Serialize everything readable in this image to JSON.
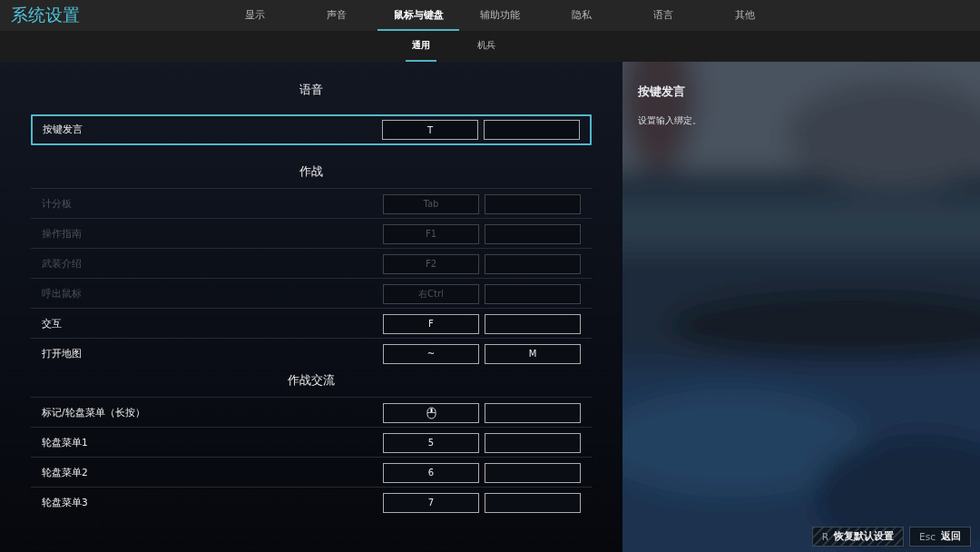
{
  "window": {
    "title": "系统设置"
  },
  "tabs": [
    {
      "label": "显示",
      "selected": false
    },
    {
      "label": "声音",
      "selected": false
    },
    {
      "label": "鼠标与键盘",
      "selected": true
    },
    {
      "label": "辅助功能",
      "selected": false
    },
    {
      "label": "隐私",
      "selected": false
    },
    {
      "label": "语言",
      "selected": false
    },
    {
      "label": "其他",
      "selected": false
    }
  ],
  "subtabs": [
    {
      "label": "通用",
      "selected": true
    },
    {
      "label": "机兵",
      "selected": false
    }
  ],
  "sections": [
    {
      "title": "语音",
      "rows": [
        {
          "label": "按键发言",
          "selected": true,
          "disabled": false,
          "bindings": [
            {
              "kind": "text",
              "label": "T"
            },
            {
              "kind": "empty"
            }
          ]
        }
      ]
    },
    {
      "title": "作战",
      "rows": [
        {
          "label": "计分板",
          "selected": false,
          "disabled": true,
          "bindings": [
            {
              "kind": "text",
              "label": "Tab"
            },
            {
              "kind": "empty"
            }
          ]
        },
        {
          "label": "操作指南",
          "selected": false,
          "disabled": true,
          "bindings": [
            {
              "kind": "text",
              "label": "F1"
            },
            {
              "kind": "empty"
            }
          ]
        },
        {
          "label": "武装介绍",
          "selected": false,
          "disabled": true,
          "bindings": [
            {
              "kind": "text",
              "label": "F2"
            },
            {
              "kind": "empty"
            }
          ]
        },
        {
          "label": "呼出鼠标",
          "selected": false,
          "disabled": true,
          "bindings": [
            {
              "kind": "text",
              "label": "右Ctrl"
            },
            {
              "kind": "empty"
            }
          ]
        },
        {
          "label": "交互",
          "selected": false,
          "disabled": false,
          "bindings": [
            {
              "kind": "text",
              "label": "F"
            },
            {
              "kind": "empty"
            }
          ]
        },
        {
          "label": "打开地图",
          "selected": false,
          "disabled": false,
          "bindings": [
            {
              "kind": "text",
              "label": "~"
            },
            {
              "kind": "text",
              "label": "M"
            }
          ]
        }
      ]
    },
    {
      "title": "作战交流",
      "rows": [
        {
          "label": "标记/轮盘菜单（长按）",
          "selected": false,
          "disabled": false,
          "bindings": [
            {
              "kind": "mouse"
            },
            {
              "kind": "empty"
            }
          ]
        },
        {
          "label": "轮盘菜单1",
          "selected": false,
          "disabled": false,
          "bindings": [
            {
              "kind": "text",
              "label": "5"
            },
            {
              "kind": "empty"
            }
          ]
        },
        {
          "label": "轮盘菜单2",
          "selected": false,
          "disabled": false,
          "bindings": [
            {
              "kind": "text",
              "label": "6"
            },
            {
              "kind": "empty"
            }
          ]
        },
        {
          "label": "轮盘菜单3",
          "selected": false,
          "disabled": false,
          "bindings": [
            {
              "kind": "text",
              "label": "7"
            },
            {
              "kind": "empty"
            }
          ]
        }
      ]
    }
  ],
  "details": {
    "title": "按键发言",
    "description": "设置输入绑定。"
  },
  "footer": [
    {
      "key": "R",
      "label": "恢复默认设置",
      "kind": "hatched"
    },
    {
      "key": "Esc",
      "label": "返回",
      "kind": "plain"
    }
  ]
}
